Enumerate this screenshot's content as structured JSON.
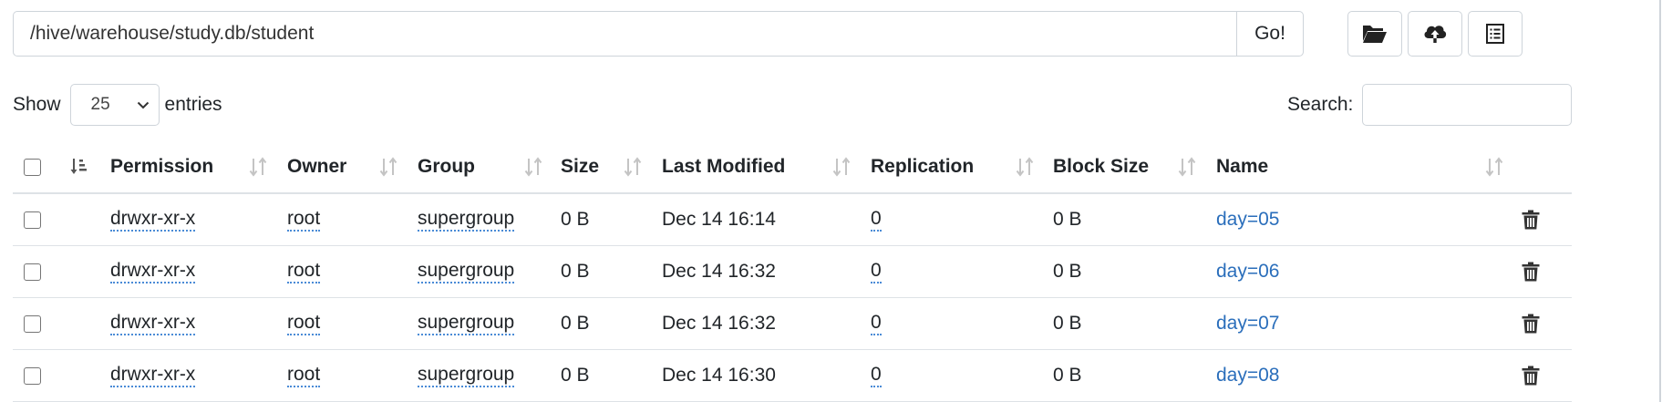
{
  "path_bar": {
    "path_value": "/hive/warehouse/study.db/student",
    "go_label": "Go!"
  },
  "toolbar": {
    "icons": [
      "folder-open-icon",
      "cloud-upload-icon",
      "list-alt-icon"
    ]
  },
  "controls": {
    "show_label": "Show",
    "entries_value": "25",
    "entries_label": "entries",
    "search_label": "Search:",
    "search_value": ""
  },
  "table": {
    "columns": [
      "Permission",
      "Owner",
      "Group",
      "Size",
      "Last Modified",
      "Replication",
      "Block Size",
      "Name"
    ],
    "rows": [
      {
        "permission": "drwxr-xr-x",
        "owner": "root",
        "group": "supergroup",
        "size": "0 B",
        "last_modified": "Dec 14 16:14",
        "replication": "0",
        "block_size": "0 B",
        "name": "day=05"
      },
      {
        "permission": "drwxr-xr-x",
        "owner": "root",
        "group": "supergroup",
        "size": "0 B",
        "last_modified": "Dec 14 16:32",
        "replication": "0",
        "block_size": "0 B",
        "name": "day=06"
      },
      {
        "permission": "drwxr-xr-x",
        "owner": "root",
        "group": "supergroup",
        "size": "0 B",
        "last_modified": "Dec 14 16:32",
        "replication": "0",
        "block_size": "0 B",
        "name": "day=07"
      },
      {
        "permission": "drwxr-xr-x",
        "owner": "root",
        "group": "supergroup",
        "size": "0 B",
        "last_modified": "Dec 14 16:30",
        "replication": "0",
        "block_size": "0 B",
        "name": "day=08"
      }
    ]
  },
  "colors": {
    "link": "#2a6ebb",
    "dotted_underline": "#4a8bd6",
    "border": "#ced4da"
  }
}
